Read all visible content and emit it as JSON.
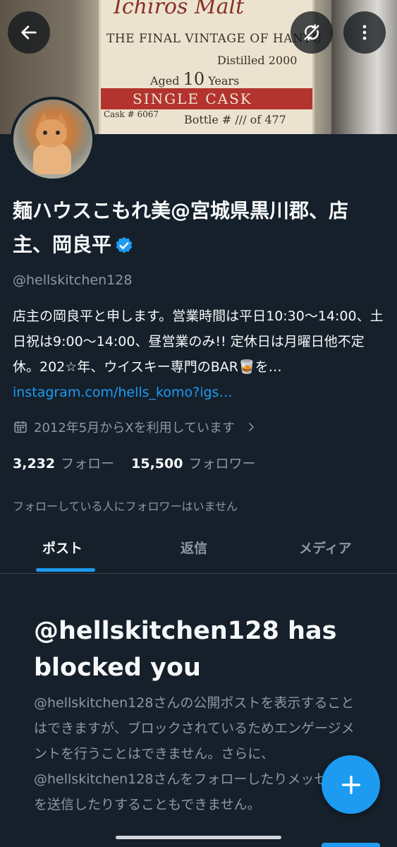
{
  "banner": {
    "label_top": "Ichiros Malt",
    "label_vintage": "THE FINAL VINTAGE OF HANYU",
    "label_distilled": "Distilled 2000",
    "label_aged": "Aged",
    "label_aged_years": "10",
    "label_years": "Years",
    "label_single": "SINGLE CASK",
    "label_cask": "Cask # 6067",
    "label_bottle": "Bottle # /// of 477"
  },
  "profile": {
    "name": "麺ハウスこもれ美@宮城県黒川郡、店主、岡良平",
    "handle": "@hellskitchen128",
    "bio_text": "店主の岡良平と申します。営業時間は平日10:30〜14:00、土日祝は9:00〜14:00、昼営業のみ!! 定休日は月曜日他不定休。202☆年、ウイスキー専門のBAR🥃を…",
    "bio_link": "instagram.com/hells_komo?igs…",
    "joined": "2012年5月からXを利用しています",
    "following_count": "3,232",
    "following_label": "フォロー",
    "followers_count": "15,500",
    "followers_label": "フォロワー",
    "followers_note": "フォローしている人にフォロワーはいません"
  },
  "tabs": [
    "ポスト",
    "返信",
    "メディア"
  ],
  "blocked": {
    "title": "@hellskitchen128 has blocked you",
    "body": "@hellskitchen128さんの公開ポストを表示することはできますが、ブロックされているためエンゲージメントを行うことはできません。さらに、@hellskitchen128さんをフォローしたりメッセージを送信したりすることもできません。"
  },
  "colors": {
    "accent": "#1d9bf0",
    "background": "#15202b",
    "muted": "#8b98a5"
  },
  "icons": [
    "back-arrow-icon",
    "sync-off-icon",
    "more-vertical-icon",
    "verified-badge-icon",
    "calendar-icon",
    "chevron-right-icon",
    "plus-icon"
  ]
}
